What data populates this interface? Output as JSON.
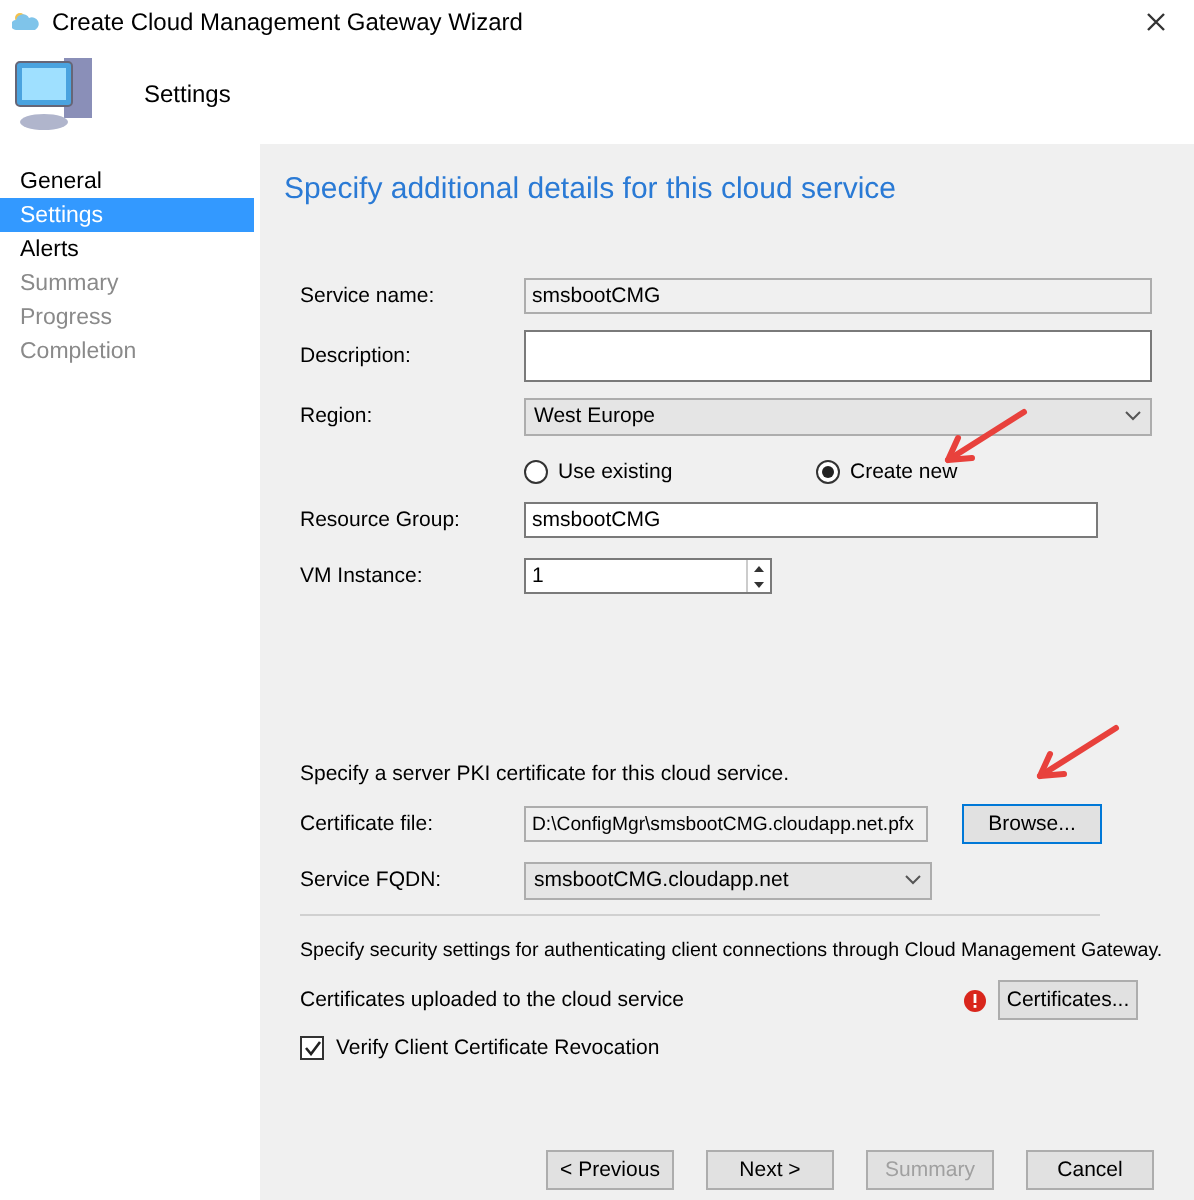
{
  "window": {
    "title": "Create Cloud Management Gateway Wizard"
  },
  "header": {
    "title": "Settings"
  },
  "steps": [
    {
      "label": "General",
      "selected": false,
      "disabled": false
    },
    {
      "label": "Settings",
      "selected": true,
      "disabled": false
    },
    {
      "label": "Alerts",
      "selected": false,
      "disabled": false
    },
    {
      "label": "Summary",
      "selected": false,
      "disabled": true
    },
    {
      "label": "Progress",
      "selected": false,
      "disabled": true
    },
    {
      "label": "Completion",
      "selected": false,
      "disabled": true
    }
  ],
  "page": {
    "heading": "Specify additional details for this cloud service",
    "service_name": {
      "label": "Service name:",
      "value": "smsbootCMG"
    },
    "description": {
      "label": "Description:"
    },
    "region": {
      "label": "Region:",
      "value": "West Europe"
    },
    "resource_options": [
      {
        "label": "Use existing",
        "selected": false
      },
      {
        "label": "Create new",
        "selected": true
      }
    ],
    "resource_group": {
      "label": "Resource Group:",
      "value": "smsbootCMG"
    },
    "vm_instance": {
      "label": "VM Instance:",
      "value": "1"
    },
    "pki_text": "Specify a server PKI certificate for this cloud service.",
    "certificate_file": {
      "label": "Certificate file:",
      "value": "D:\\ConfigMgr\\smsbootCMG.cloudapp.net.pfx",
      "button": "Browse..."
    },
    "service_fqdn": {
      "label": "Service FQDN:",
      "value": "smsbootCMG.cloudapp.net"
    },
    "security_text": "Specify security settings for authenticating client connections through Cloud Management Gateway.",
    "certificates": {
      "label": "Certificates uploaded to the cloud service",
      "button": "Certificates...",
      "error": true
    },
    "verify_revocation": {
      "label": "Verify Client Certificate Revocation",
      "checked": true
    }
  },
  "buttons": [
    {
      "label": "< Previous",
      "disabled": false
    },
    {
      "label": "Next >",
      "disabled": false
    },
    {
      "label": "Summary",
      "disabled": true
    },
    {
      "label": "Cancel",
      "disabled": false
    }
  ]
}
